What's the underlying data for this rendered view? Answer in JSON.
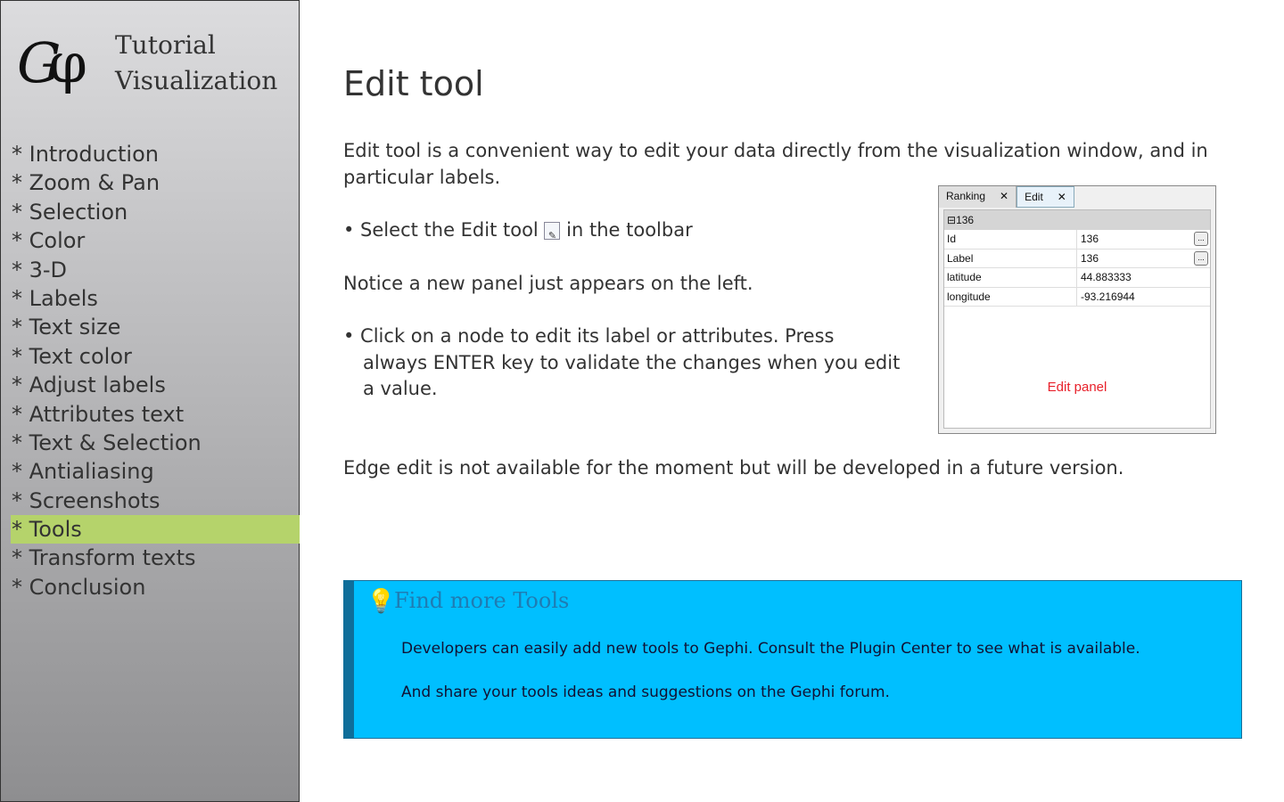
{
  "sidebar": {
    "logo": "Gφ",
    "brand_line1": "Tutorial",
    "brand_line2": "Visualization",
    "items": [
      "* Introduction",
      "* Zoom & Pan",
      "* Selection",
      "* Color",
      "* 3-D",
      "* Labels",
      "* Text size",
      "* Text color",
      "* Adjust labels",
      "* Attributes text",
      "* Text & Selection",
      "* Antialiasing",
      "* Screenshots",
      "* Tools",
      "* Transform texts",
      "* Conclusion"
    ],
    "active": "* Tools"
  },
  "main": {
    "title": "Edit tool",
    "intro": "Edit tool is a convenient way to edit your data directly from the visualization window, and in particular labels.",
    "step1_pre": "• Select the Edit tool",
    "step1_post": "in the toolbar",
    "notice": "Notice a new panel just appears on the left.",
    "step2_a": "• Click on a node to edit its label or attributes. Press",
    "step2_b": "always ENTER key to validate the changes when you edit",
    "step2_c": "a value.",
    "edge": "Edge edit is not available for the moment but will be developed in a future version."
  },
  "panel": {
    "tabs": [
      "Ranking",
      "Edit"
    ],
    "group": "136",
    "rows": [
      {
        "k": "Id",
        "v": "136"
      },
      {
        "k": "Label",
        "v": "136"
      },
      {
        "k": "latitude",
        "v": "44.883333"
      },
      {
        "k": "longitude",
        "v": "-93.216944"
      }
    ],
    "caption": "Edit panel",
    "dots": "..."
  },
  "tip": {
    "title": "Find more Tools",
    "p1": "Developers can easily add new tools to Gephi. Consult the Plugin Center to see what is available.",
    "p2": "And share your tools ideas and suggestions on the Gephi forum."
  }
}
